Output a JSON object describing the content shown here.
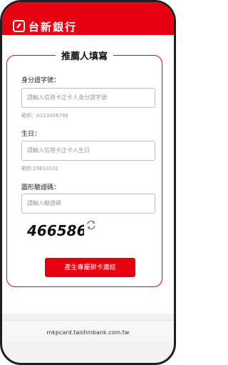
{
  "header": {
    "brand": "台新銀行"
  },
  "card": {
    "title": "推薦人填寫"
  },
  "form": {
    "id_label": "身分證字號：",
    "id_placeholder": "請輸入信用卡正卡人身分證字號",
    "id_hint": "範例：A123456789",
    "birth_label": "生日：",
    "birth_placeholder": "請輸入信用卡正卡人生日",
    "birth_hint": "範例:19610101",
    "captcha_label": "圖形驗證碼：",
    "captcha_placeholder": "請輸入驗證碼",
    "captcha_value": "466586",
    "submit_label": "產生專屬辦卡連結"
  },
  "footer": {
    "url": "mkpcard.taishinbank.com.tw"
  },
  "colors": {
    "brand_red": "#e60012"
  }
}
